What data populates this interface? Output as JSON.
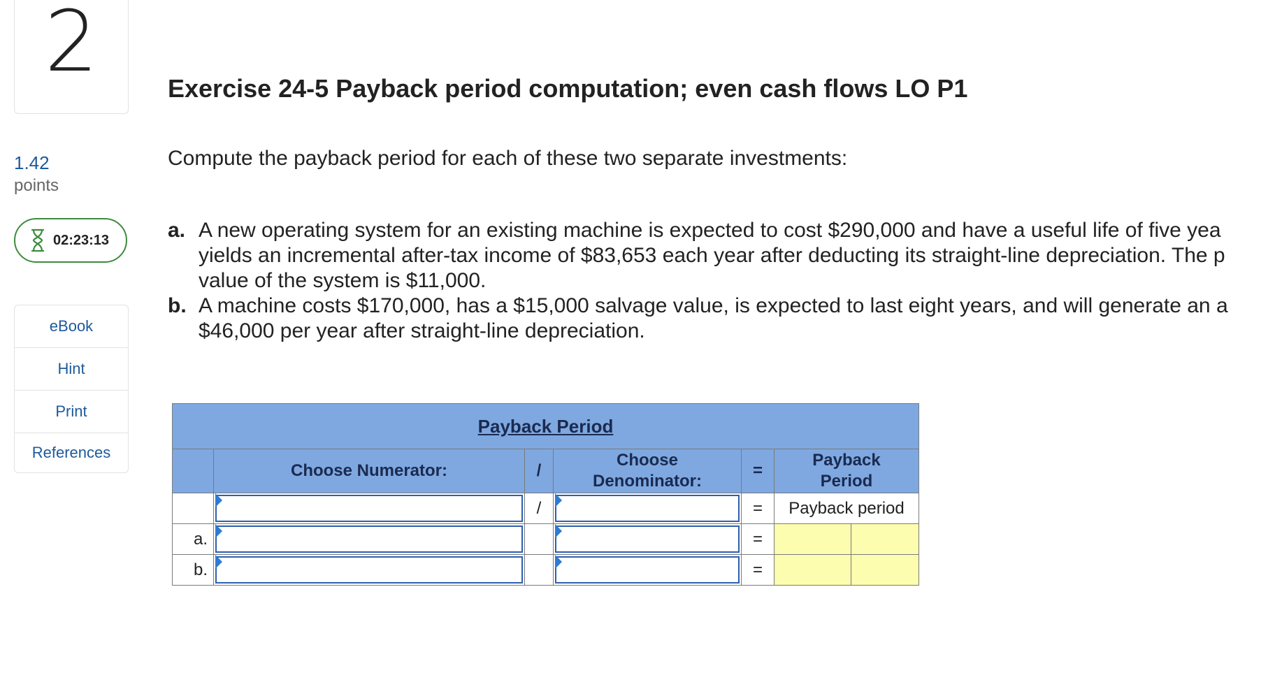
{
  "question": {
    "number": "2",
    "points_value": "1.42",
    "points_label": "points"
  },
  "timer": {
    "value": "02:23:13"
  },
  "side_menu": [
    "eBook",
    "Hint",
    "Print",
    "References"
  ],
  "title": "Exercise 24-5 Payback period computation; even cash flows LO P1",
  "instruction": "Compute the payback period for each of these two separate investments:",
  "items": [
    {
      "letter": "a.",
      "lines": [
        "A new operating system for an existing machine is expected to cost $290,000 and have a useful life of five yea",
        "yields an incremental after-tax income of $83,653 each year after deducting its straight-line depreciation. The p",
        "value of the system is $11,000."
      ]
    },
    {
      "letter": "b.",
      "lines": [
        "A machine costs $170,000, has a $15,000 salvage value, is expected to last eight years, and will generate an a",
        "$46,000 per year after straight-line depreciation."
      ]
    }
  ],
  "table": {
    "title": "Payback Period",
    "headers": {
      "numerator": "Choose Numerator:",
      "divide": "/",
      "denominator_line1": "Choose",
      "denominator_line2": "Denominator:",
      "equals": "=",
      "result_line1": "Payback",
      "result_line2": "Period"
    },
    "row0": {
      "divide": "/",
      "equals": "=",
      "result": "Payback period"
    },
    "row_a": {
      "label": "a.",
      "equals": "="
    },
    "row_b": {
      "label": "b.",
      "equals": "="
    }
  }
}
